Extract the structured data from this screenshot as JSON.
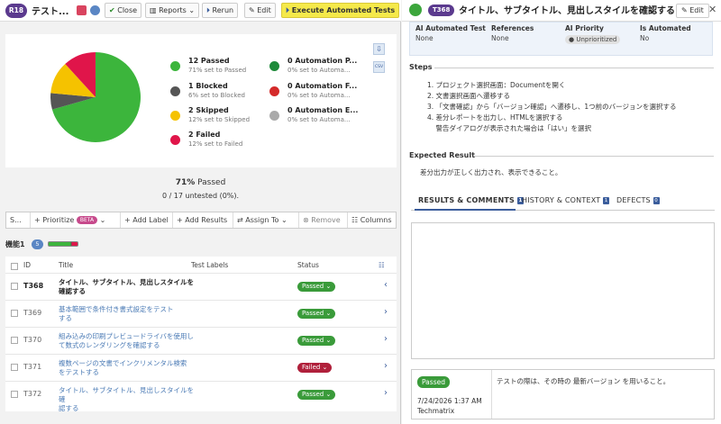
{
  "run": {
    "badge": "R18",
    "title": "テスト...",
    "toolbar": {
      "close": "Close",
      "reports": "Reports",
      "rerun": "Rerun",
      "edit": "Edit",
      "execute": "Execute Automated Tests"
    }
  },
  "summary": {
    "legend": [
      {
        "title": "12 Passed",
        "sub": "71% set to Passed",
        "color": "#3cb53c"
      },
      {
        "title": "1 Blocked",
        "sub": "6% set to Blocked",
        "color": "#555555"
      },
      {
        "title": "2 Skipped",
        "sub": "12% set to Skipped",
        "color": "#f5c200"
      },
      {
        "title": "2 Failed",
        "sub": "12% set to Failed",
        "color": "#e0154a"
      },
      {
        "title": "0 Automation P...",
        "sub": "0% set to Automa...",
        "color": "#1e8a3a"
      },
      {
        "title": "0 Automation F...",
        "sub": "0% set to Automa...",
        "color": "#d42a2a"
      },
      {
        "title": "0 Automation E...",
        "sub": "0% set to Automa...",
        "color": "#aaaaaa"
      }
    ],
    "pie": [
      {
        "label": "Passed",
        "fraction": 0.7059,
        "color": "#3cb53c"
      },
      {
        "label": "Blocked",
        "fraction": 0.0588,
        "color": "#555555"
      },
      {
        "label": "Skipped",
        "fraction": 0.1176,
        "color": "#f5c200"
      },
      {
        "label": "Failed",
        "fraction": 0.1176,
        "color": "#e0154a"
      }
    ],
    "passed_pct": "71%",
    "passed_word": " Passed",
    "untested": "0 / 17 untested (0%).",
    "csv_label": "CSV"
  },
  "toolbar2": {
    "select": "S...",
    "prioritize": "+ Prioritize",
    "beta": "BETA",
    "add_label": "+ Add Label",
    "add_results": "+ Add Results",
    "assign_to": "Assign To",
    "remove": "Remove",
    "columns": "Columns"
  },
  "group": {
    "name": "機能1",
    "count": "5"
  },
  "table": {
    "headers": {
      "id": "ID",
      "title": "Title",
      "labels": "Test Labels",
      "status": "Status"
    },
    "rows": [
      {
        "id": "T368",
        "title1": "タイトル、サブタイトル、見出しスタイルを",
        "title2": "確認する",
        "status": "Passed",
        "type": "pass",
        "selected": true
      },
      {
        "id": "T369",
        "title1": "基本範囲で条件付き書式設定をテスト",
        "title2": "する",
        "status": "Passed",
        "type": "pass",
        "selected": false
      },
      {
        "id": "T370",
        "title1": "組み込みの印刷プレビュードライバを使用し",
        "title2": "て数式のレンダリングを確認する",
        "status": "Passed",
        "type": "pass",
        "selected": false
      },
      {
        "id": "T371",
        "title1": "複数ページの文書でインクリメンタル検索",
        "title2": "をテストする",
        "status": "Failed",
        "type": "fail",
        "selected": false
      },
      {
        "id": "T372",
        "title1": "タイトル、サブタイトル、見出しスタイルを確",
        "title2": "認する",
        "status": "Passed",
        "type": "pass",
        "selected": false
      }
    ]
  },
  "detail": {
    "badge": "T368",
    "title": "タイトル、サブタイトル、見出しスタイルを確認する",
    "edit": "Edit",
    "props": [
      {
        "label": "AI Automated Test",
        "value": "None"
      },
      {
        "label": "References",
        "value": "None"
      },
      {
        "label": "AI Priority",
        "value": "Unprioritized"
      },
      {
        "label": "Is Automated",
        "value": "No"
      }
    ],
    "steps_title": "Steps",
    "steps": [
      "1. プロジェクト選択画面：Documentを開く",
      "2. 文書選択画面へ遷移する",
      "3. 「文書確認」から「バージョン確認」へ遷移し、1つ前のバージョンを選択する",
      "4. 差分レポートを出力し、HTMLを選択する",
      "    警告ダイアログが表示された場合は「はい」を選択"
    ],
    "expected_title": "Expected Result",
    "expected": "差分出力が正しく出力され、表示できること。",
    "tabs": [
      {
        "label": "RESULTS & COMMENTS",
        "count": "1"
      },
      {
        "label": "HISTORY & CONTEXT",
        "count": "1"
      },
      {
        "label": "DEFECTS",
        "count": "0"
      }
    ],
    "result": {
      "status": "Passed",
      "date": "7/24/2026 1:37 AM",
      "user": "Techmatrix",
      "comment": "テストの際は、その時の 最新バージョン を用いること。"
    }
  }
}
